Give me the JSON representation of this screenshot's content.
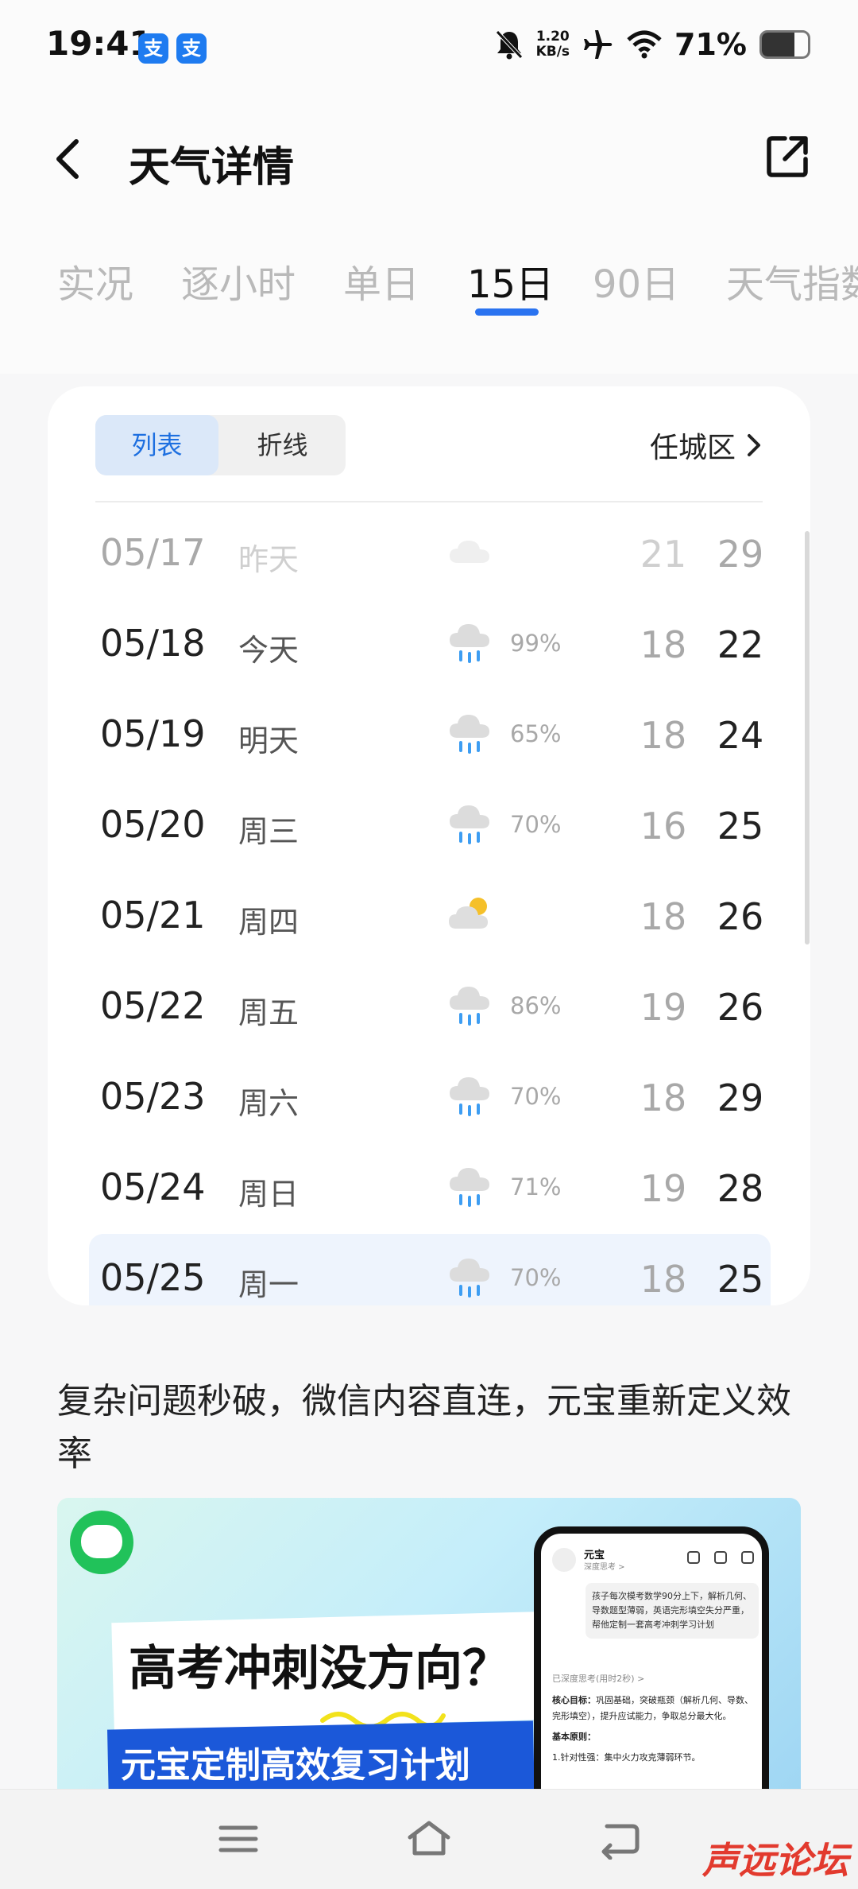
{
  "status_bar": {
    "time": "19:41",
    "app_icons": [
      "支",
      "支"
    ],
    "net_speed_value": "1.20",
    "net_speed_unit": "KB/s",
    "battery_percent": "71%",
    "battery_level": 0.71,
    "icons": [
      "silent-bell-icon",
      "airplane-icon",
      "wifi-icon",
      "battery-icon"
    ]
  },
  "header": {
    "title": "天气详情"
  },
  "tabs": [
    {
      "label": "实况",
      "active": false
    },
    {
      "label": "逐小时",
      "active": false
    },
    {
      "label": "单日",
      "active": false
    },
    {
      "label": "15日",
      "active": true
    },
    {
      "label": "90日",
      "active": false
    },
    {
      "label": "天气指数",
      "active": false
    }
  ],
  "card": {
    "view_toggle": [
      "列表",
      "折线"
    ],
    "active_view": "列表",
    "district": "任城区"
  },
  "forecast": [
    {
      "date": "05/17",
      "day": "昨天",
      "icon": "cloudy-icon",
      "rain": "",
      "low": "21",
      "high": "29"
    },
    {
      "date": "05/18",
      "day": "今天",
      "icon": "rain-icon",
      "rain": "99%",
      "low": "18",
      "high": "22"
    },
    {
      "date": "05/19",
      "day": "明天",
      "icon": "rain-icon",
      "rain": "65%",
      "low": "18",
      "high": "24"
    },
    {
      "date": "05/20",
      "day": "周三",
      "icon": "rain-icon",
      "rain": "70%",
      "low": "16",
      "high": "25"
    },
    {
      "date": "05/21",
      "day": "周四",
      "icon": "partly-cloudy-icon",
      "rain": "",
      "low": "18",
      "high": "26"
    },
    {
      "date": "05/22",
      "day": "周五",
      "icon": "rain-icon",
      "rain": "86%",
      "low": "19",
      "high": "26"
    },
    {
      "date": "05/23",
      "day": "周六",
      "icon": "rain-icon",
      "rain": "70%",
      "low": "18",
      "high": "29"
    },
    {
      "date": "05/24",
      "day": "周日",
      "icon": "rain-icon",
      "rain": "71%",
      "low": "19",
      "high": "28"
    },
    {
      "date": "05/25",
      "day": "周一",
      "icon": "rain-icon",
      "rain": "70%",
      "low": "18",
      "high": "25"
    }
  ],
  "ad": {
    "title": "复杂问题秒破，微信内容直连，元宝重新定义效率",
    "headline": "高考冲刺没方向？",
    "subline": "元宝定制高效复习计划",
    "phone": {
      "name": "元宝",
      "sub": "深度思考 >",
      "bubble": "孩子每次模考数学90分上下，解析几何、导数题型薄弱，英语完形填空失分严重，帮他定制一套高考冲刺学习计划",
      "thinking": "已深度思考(用时2秒) >",
      "goal_label": "核心目标：",
      "goal_text": "巩固基础，突破瓶颈（解析几何、导数、完形填空），提升应试能力，争取总分最大化。",
      "principle_label": "基本原则：",
      "principle_item": "1.针对性强：集中火力攻克薄弱环节。"
    }
  },
  "watermark": "声远论坛",
  "colors": {
    "accent": "#2a73f0",
    "toggle_active_bg": "#dbe8f9",
    "rain_drop": "#3d9df2",
    "sun": "#f5c02a"
  }
}
